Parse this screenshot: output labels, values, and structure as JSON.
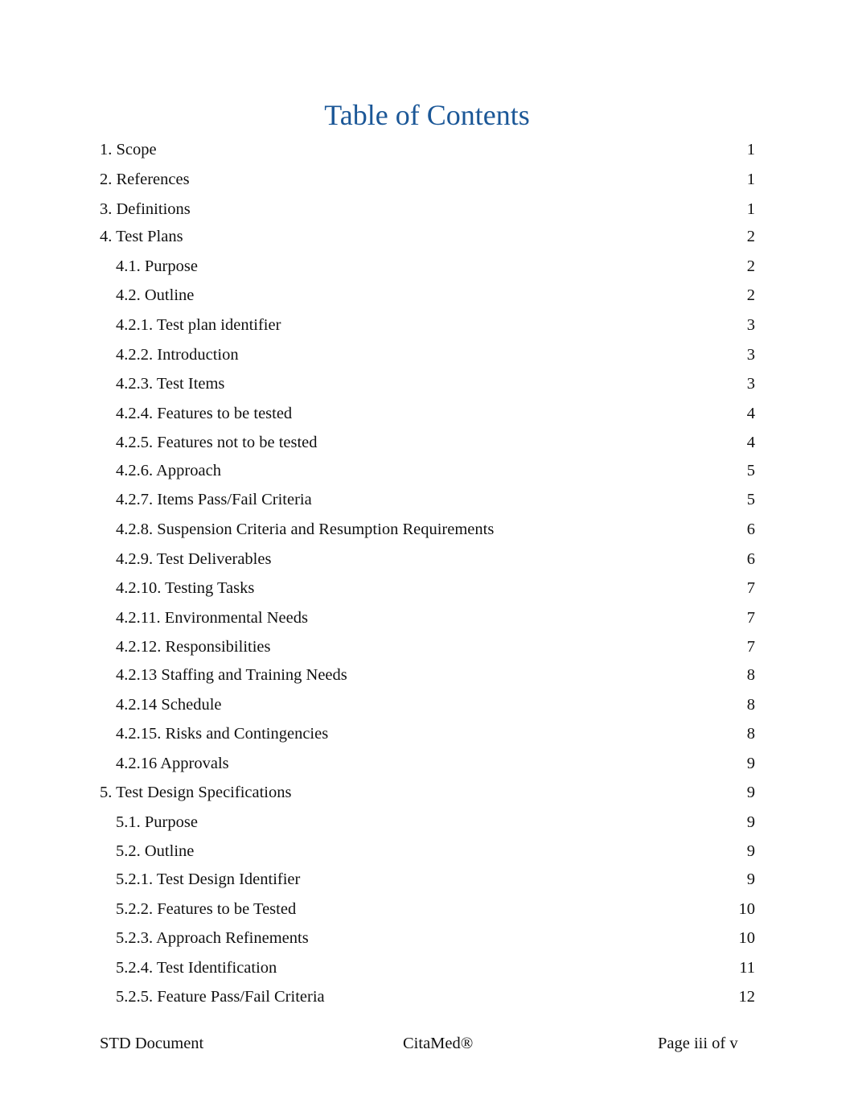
{
  "title": "Table of Contents",
  "toc": [
    {
      "label": "1. Scope",
      "page": "1",
      "level": 1
    },
    {
      "label": "2. References",
      "page": "1",
      "level": 1
    },
    {
      "label": "3. Definitions",
      "page": "1",
      "level": 1
    },
    {
      "label": "4. Test Plans",
      "page": "2",
      "level": 1
    },
    {
      "label": "4.1. Purpose",
      "page": "2",
      "level": 2
    },
    {
      "label": "4.2. Outline",
      "page": "2",
      "level": 2
    },
    {
      "label": "4.2.1. Test plan identifier",
      "page": "3",
      "level": 2
    },
    {
      "label": "4.2.2. Introduction",
      "page": "3",
      "level": 2
    },
    {
      "label": "4.2.3. Test Items",
      "page": "3",
      "level": 2
    },
    {
      "label": "4.2.4. Features to be tested",
      "page": "4",
      "level": 2
    },
    {
      "label": "4.2.5. Features not to be tested",
      "page": "4",
      "level": 2
    },
    {
      "label": "4.2.6. Approach",
      "page": "5",
      "level": 2
    },
    {
      "label": "4.2.7. Items Pass/Fail Criteria",
      "page": "5",
      "level": 2
    },
    {
      "label": "4.2.8. Suspension Criteria and Resumption Requirements",
      "page": "6",
      "level": 2
    },
    {
      "label": "4.2.9. Test Deliverables",
      "page": "6",
      "level": 2
    },
    {
      "label": "4.2.10. Testing Tasks",
      "page": "7",
      "level": 2
    },
    {
      "label": "4.2.11. Environmental Needs",
      "page": "7",
      "level": 2
    },
    {
      "label": "4.2.12. Responsibilities",
      "page": "7",
      "level": 2
    },
    {
      "label": "4.2.13 Staffing and Training Needs",
      "page": "8",
      "level": 2
    },
    {
      "label": "4.2.14 Schedule",
      "page": "8",
      "level": 2
    },
    {
      "label": "4.2.15. Risks and Contingencies",
      "page": "8",
      "level": 2
    },
    {
      "label": "4.2.16 Approvals",
      "page": "9",
      "level": 2
    },
    {
      "label": "5. Test Design Specifications",
      "page": "9",
      "level": 1
    },
    {
      "label": "5.1. Purpose",
      "page": "9",
      "level": 2
    },
    {
      "label": "5.2. Outline",
      "page": "9",
      "level": 2
    },
    {
      "label": "5.2.1. Test Design Identifier",
      "page": "9",
      "level": 2
    },
    {
      "label": "5.2.2. Features to be Tested",
      "page": "10",
      "level": 2
    },
    {
      "label": "5.2.3. Approach Refinements",
      "page": "10",
      "level": 2
    },
    {
      "label": "5.2.4. Test Identification",
      "page": "11",
      "level": 2
    },
    {
      "label": "5.2.5. Feature Pass/Fail Criteria",
      "page": "12",
      "level": 2
    }
  ],
  "footer": {
    "left": "STD Document",
    "center": "CitaMed®",
    "right": "Page iii of v"
  }
}
